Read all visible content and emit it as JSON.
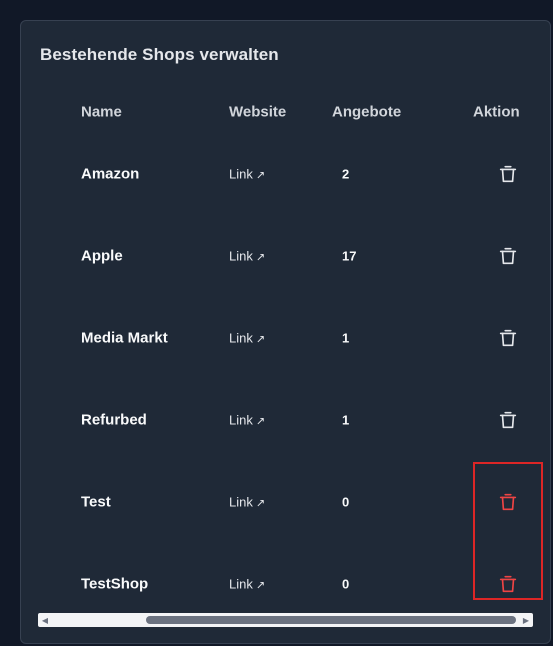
{
  "panel": {
    "title": "Bestehende Shops verwalten"
  },
  "table": {
    "headers": {
      "name": "Name",
      "website": "Website",
      "offers": "Angebote",
      "action": "Aktion"
    },
    "rows": [
      {
        "name": "Amazon",
        "website": "Link",
        "offers": "2",
        "delete_highlighted": false
      },
      {
        "name": "Apple",
        "website": "Link",
        "offers": "17",
        "delete_highlighted": false
      },
      {
        "name": "Media Markt",
        "website": "Link",
        "offers": "1",
        "delete_highlighted": false
      },
      {
        "name": "Refurbed",
        "website": "Link",
        "offers": "1",
        "delete_highlighted": false
      },
      {
        "name": "Test",
        "website": "Link",
        "offers": "0",
        "delete_highlighted": true
      },
      {
        "name": "TestShop",
        "website": "Link",
        "offers": "0",
        "delete_highlighted": true
      }
    ],
    "link_arrow": "↗"
  },
  "icons": {
    "delete": "trash-icon",
    "scroll_left": "scroll-left-arrow-icon",
    "scroll_right": "scroll-right-arrow-icon"
  },
  "colors": {
    "background": "#111827",
    "panel": "#1f2937",
    "text": "#f9fafb",
    "delete_default": "#e5e7eb",
    "delete_highlighted": "#ef4444",
    "highlight_border": "#dc2626"
  },
  "scrollbar": {
    "horizontal_position": 0.22
  }
}
